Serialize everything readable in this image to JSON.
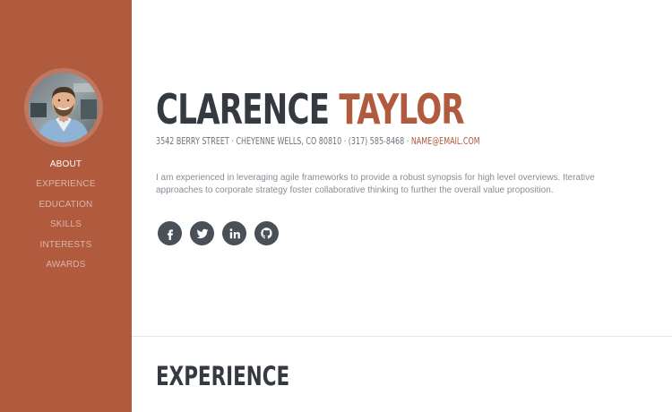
{
  "colors": {
    "accent": "#b05a3e",
    "heading": "#343a40",
    "muted_text": "#868e96",
    "social_bg": "#495057"
  },
  "sidebar": {
    "avatar_icon": "profile-photo",
    "nav_items": [
      {
        "label": "ABOUT",
        "active": true
      },
      {
        "label": "EXPERIENCE",
        "active": false
      },
      {
        "label": "EDUCATION",
        "active": false
      },
      {
        "label": "SKILLS",
        "active": false
      },
      {
        "label": "INTERESTS",
        "active": false
      },
      {
        "label": "AWARDS",
        "active": false
      }
    ]
  },
  "about": {
    "first_name": "CLARENCE",
    "last_name": "TAYLOR",
    "address": "3542 BERRY STREET · CHEYENNE WELLS, CO 80810 · (317) 585-8468 ·",
    "email": "NAME@EMAIL.COM",
    "intro": "I am experienced in leveraging agile frameworks to provide a robust synopsis for high level overviews. Iterative approaches to corporate strategy foster collaborative thinking to further the overall value proposition.",
    "social": [
      {
        "icon": "facebook-icon"
      },
      {
        "icon": "twitter-icon"
      },
      {
        "icon": "linkedin-icon"
      },
      {
        "icon": "github-icon"
      }
    ]
  },
  "experience": {
    "title": "EXPERIENCE"
  }
}
